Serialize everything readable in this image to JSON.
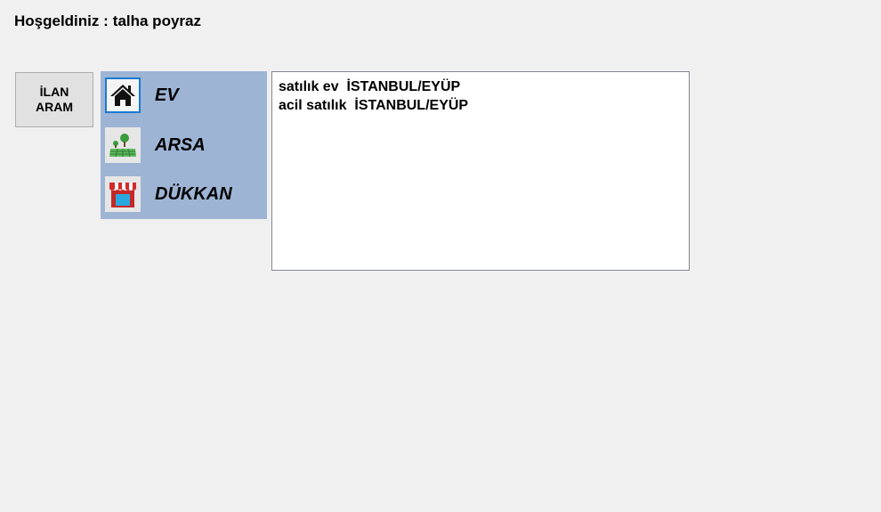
{
  "header": {
    "welcome_label": "Hoşgeldiniz :",
    "user_name": "talha poyraz"
  },
  "ilan_button": {
    "line1": "İLAN",
    "line2": "ARAM"
  },
  "categories": [
    {
      "label": "EV",
      "icon": "house-icon",
      "selected": true
    },
    {
      "label": "ARSA",
      "icon": "land-icon",
      "selected": false
    },
    {
      "label": "DÜKKAN",
      "icon": "shop-icon",
      "selected": false
    }
  ],
  "listings": [
    {
      "text": "satılık ev  İSTANBUL/EYÜP"
    },
    {
      "text": "acil satılık  İSTANBUL/EYÜP"
    }
  ],
  "colors": {
    "background": "#f0f0f0",
    "panel": "#9db4d4",
    "selection_border": "#1a7ad4",
    "awning_red": "#d42a2a",
    "land_green": "#3a9b3a"
  }
}
